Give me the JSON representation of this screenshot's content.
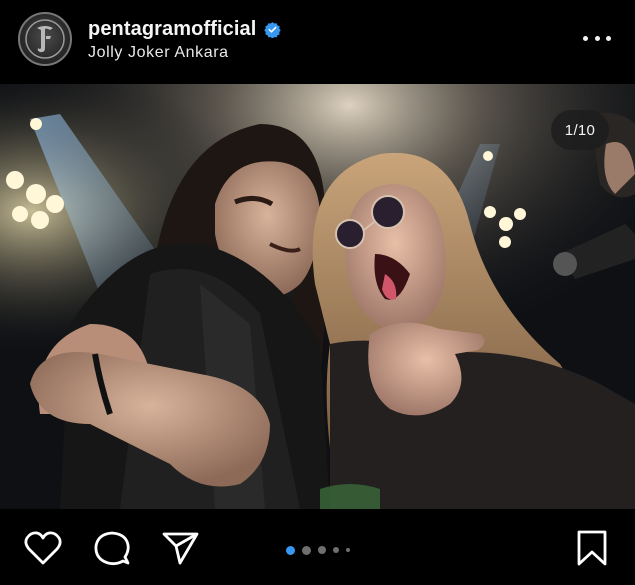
{
  "post": {
    "username": "pentagramofficial",
    "location": "Jolly Joker Ankara",
    "verified": true,
    "image_counter": "1/10",
    "carousel": {
      "total_dots": 5,
      "active_index": 0
    }
  },
  "icons": {
    "avatar": "pentagram-logo-icon",
    "verified": "verified-badge-icon",
    "more": "more-options-icon",
    "like": "heart-icon",
    "comment": "comment-icon",
    "share": "send-icon",
    "save": "bookmark-icon"
  },
  "colors": {
    "background": "#000000",
    "text": "#ffffff",
    "verified_badge": "#3897f0",
    "active_dot": "#3897f0",
    "inactive_dot": "#6f6f6f"
  }
}
